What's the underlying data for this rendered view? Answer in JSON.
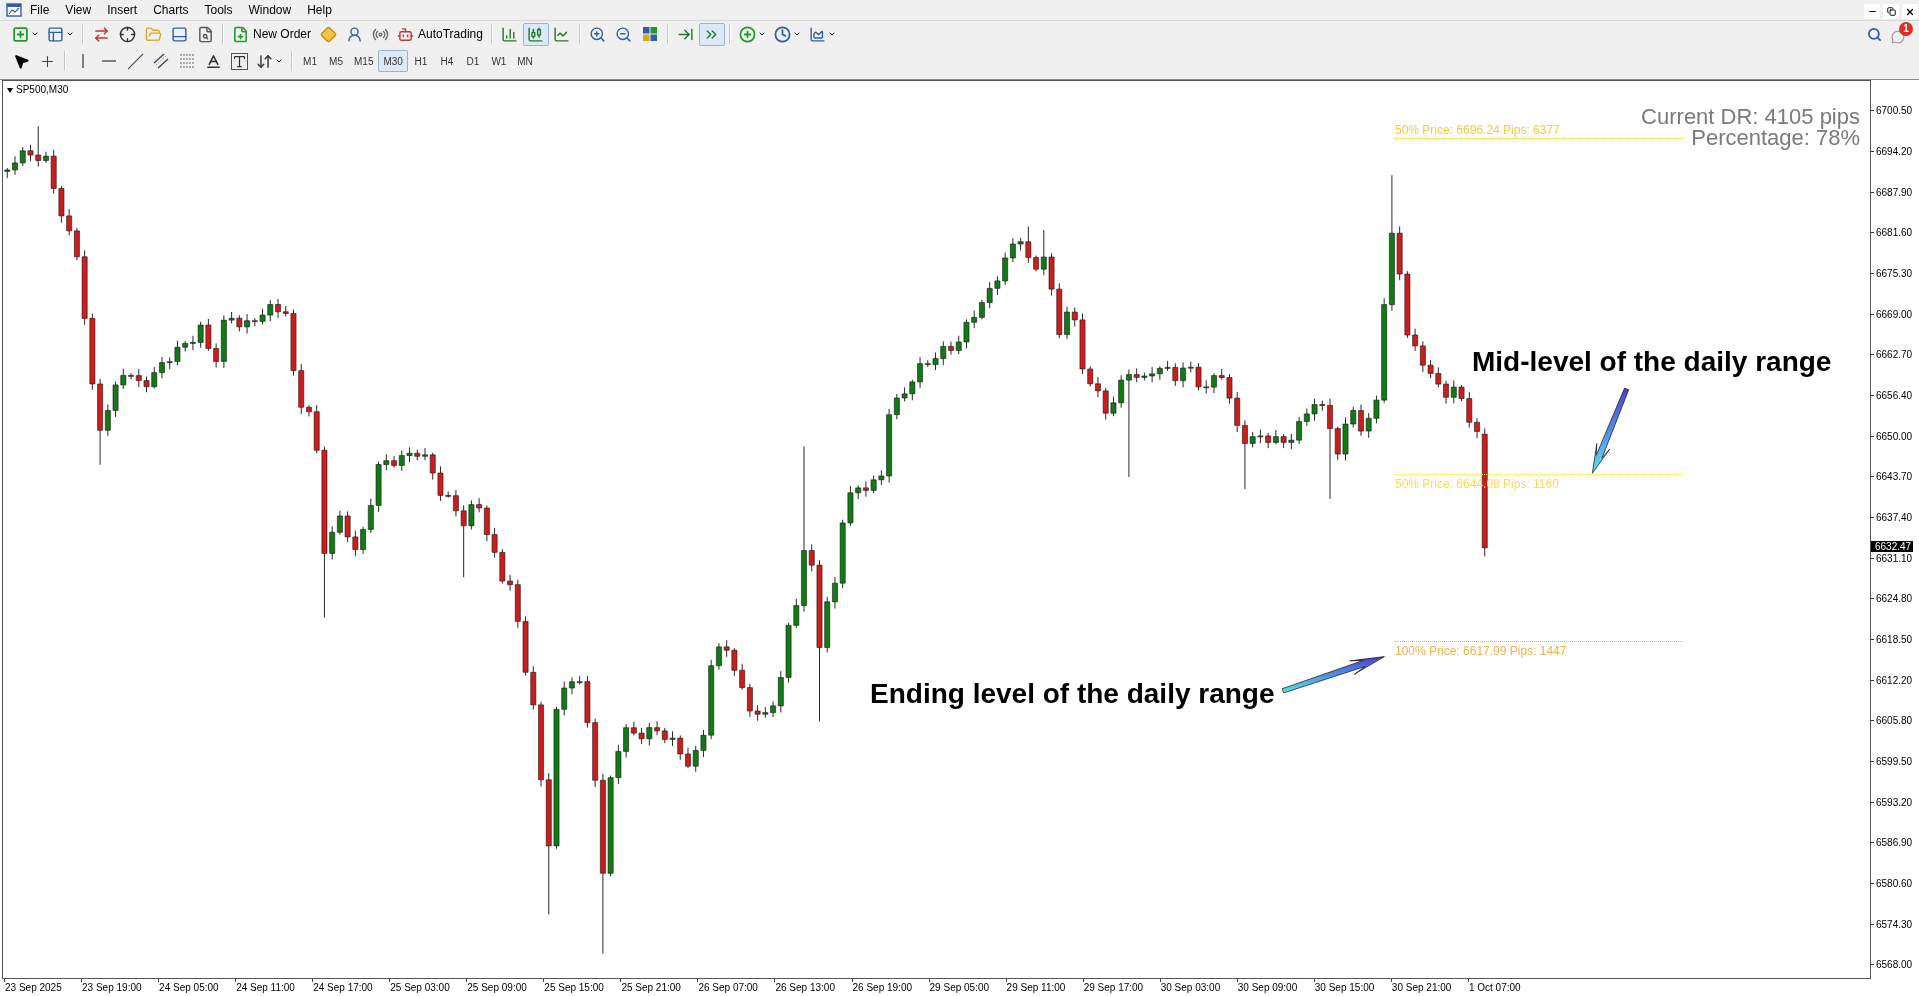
{
  "menu_bar": {
    "items": [
      "File",
      "View",
      "Insert",
      "Charts",
      "Tools",
      "Window",
      "Help"
    ]
  },
  "toolbar": {
    "new_order": "New Order",
    "auto_trading": "AutoTrading",
    "chart_types": [
      {
        "selected": false
      },
      {
        "selected": true
      },
      {
        "selected": false
      }
    ],
    "view_toggles": [
      {
        "on": false
      },
      {
        "on": true
      }
    ],
    "notifications": "1"
  },
  "drawing_toolbar": {
    "timeframes": [
      {
        "label": "M1",
        "selected": false
      },
      {
        "label": "M5",
        "selected": false
      },
      {
        "label": "M15",
        "selected": false
      },
      {
        "label": "M30",
        "selected": true
      },
      {
        "label": "H1",
        "selected": false
      },
      {
        "label": "H4",
        "selected": false
      },
      {
        "label": "D1",
        "selected": false
      },
      {
        "label": "W1",
        "selected": false
      },
      {
        "label": "MN",
        "selected": false
      }
    ]
  },
  "chart": {
    "title": "SP500,M30",
    "info": [
      "Current DR: 4105 pips",
      "Percentage: 78%"
    ],
    "levels": [
      {
        "label": "50% Price: 6696.24 Pips: 6377",
        "color": "#f2cc3d"
      },
      {
        "label": "50% Price: 6644.08 Pips: 1160",
        "color": "#fcd95c"
      },
      {
        "label": "100% Price: 6617.99 Pips: 1447",
        "color": "#f4b04a"
      }
    ],
    "annotations": [
      "Mid-level of the daily range",
      "Ending level of the daily range"
    ],
    "price_axis": {
      "labels": [
        "6700.50",
        "6694.20",
        "6687.90",
        "6681.60",
        "6675.30",
        "6669.00",
        "6662.70",
        "6656.40",
        "6650.00",
        "6643.70",
        "6637.40",
        "6631.10",
        "6624.80",
        "6618.50",
        "6612.20",
        "6605.80",
        "6599.50",
        "6593.20",
        "6586.90",
        "6580.60",
        "6574.30",
        "6568.00"
      ],
      "current_price": "6632.47"
    },
    "time_axis": {
      "labels": [
        "23 Sep 2025",
        "23 Sep 19:00",
        "24 Sep 05:00",
        "24 Sep 11:00",
        "24 Sep 17:00",
        "25 Sep 03:00",
        "25 Sep 09:00",
        "25 Sep 15:00",
        "25 Sep 21:00",
        "26 Sep 07:00",
        "26 Sep 13:00",
        "26 Sep 19:00",
        "29 Sep 05:00",
        "29 Sep 11:00",
        "29 Sep 17:00",
        "30 Sep 03:00",
        "30 Sep 09:00",
        "30 Sep 15:00",
        "30 Sep 21:00",
        "1 Oct 07:00"
      ]
    }
  }
}
